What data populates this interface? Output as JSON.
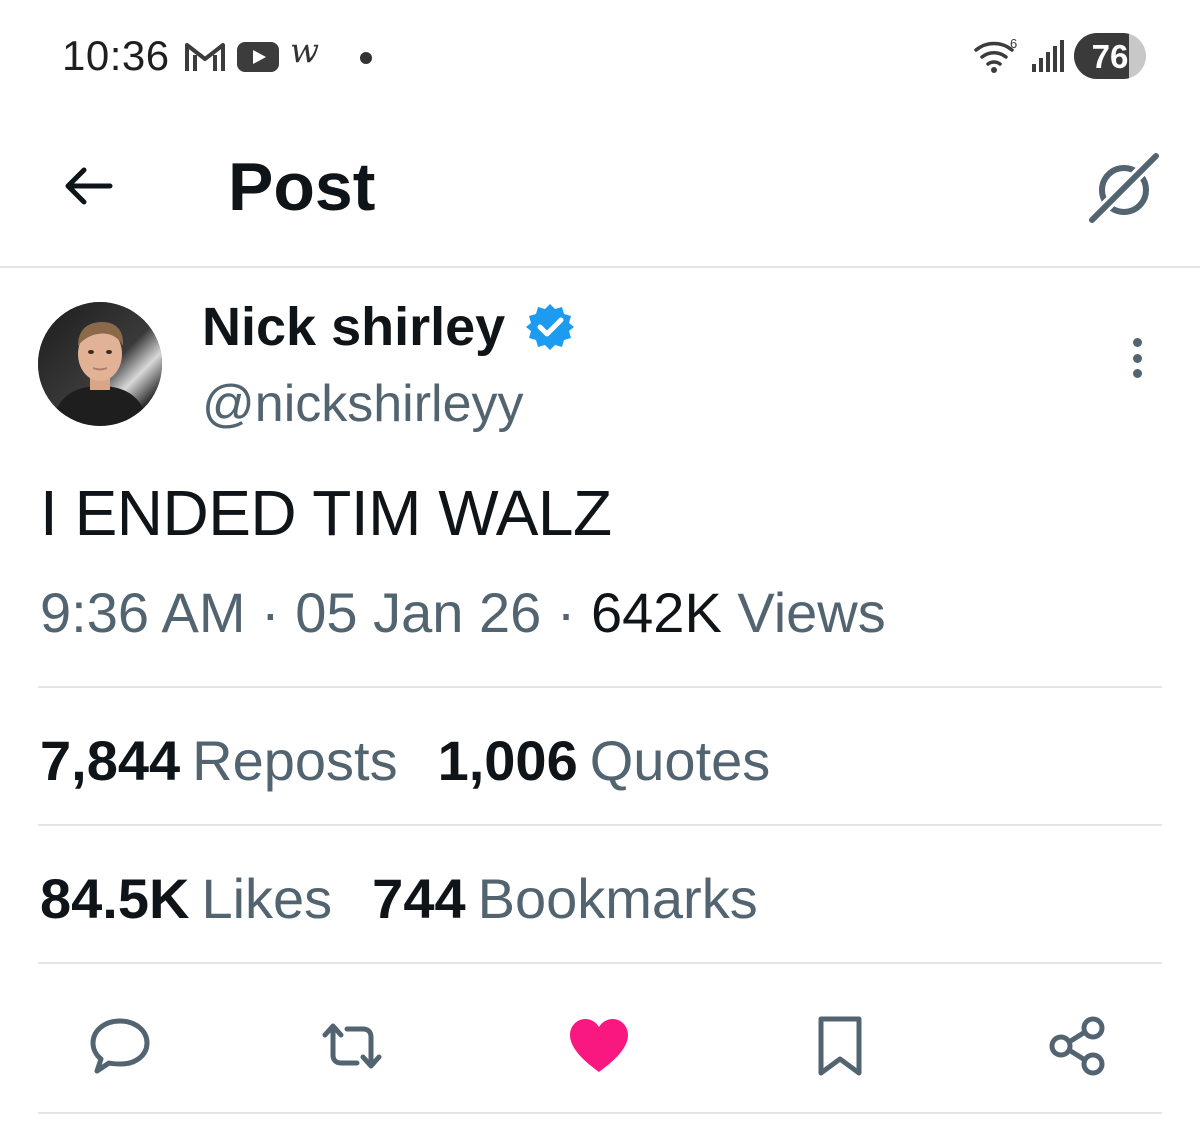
{
  "status_bar": {
    "time": "10:36",
    "notification_icons": [
      "gmail-icon",
      "youtube-icon",
      "walgreens-icon",
      "dot-icon"
    ],
    "walgreens_glyph": "w",
    "wifi_label": "6",
    "battery_level": "76",
    "battery_fraction": 0.76
  },
  "header": {
    "title": "Post"
  },
  "post": {
    "author": {
      "name": "Nick shirley",
      "handle": "@nickshirleyy",
      "verified": true
    },
    "text": "I ENDED TIM WALZ",
    "time": "9:36 AM",
    "separator": "·",
    "date": "05 Jan 26",
    "views_count": "642K",
    "views_label": "Views",
    "stats": {
      "reposts_count": "7,844",
      "reposts_label": "Reposts",
      "quotes_count": "1,006",
      "quotes_label": "Quotes",
      "likes_count": "84.5K",
      "likes_label": "Likes",
      "bookmarks_count": "744",
      "bookmarks_label": "Bookmarks"
    }
  },
  "colors": {
    "text_primary": "#0f1419",
    "text_secondary": "#536471",
    "verified_blue": "#1d9bf0",
    "like_pink": "#f91880",
    "divider": "#e3e6e8"
  },
  "actions": [
    "reply-icon",
    "repost-icon",
    "like-icon",
    "bookmark-icon",
    "share-icon"
  ]
}
